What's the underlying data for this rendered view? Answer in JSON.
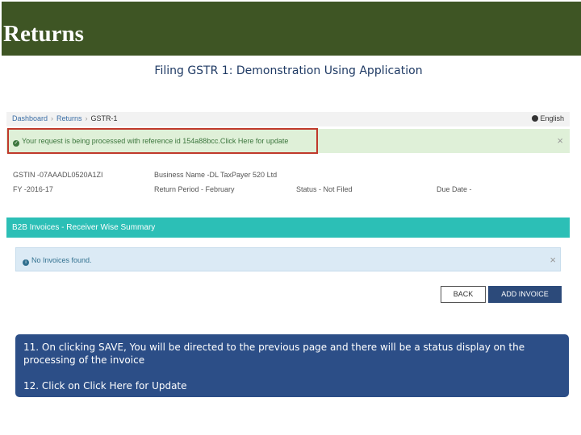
{
  "slide": {
    "title": "Returns",
    "subtitle": "Filing GSTR 1: Demonstration Using Application"
  },
  "breadcrumb": {
    "items": [
      "Dashboard",
      "Returns",
      "GSTR-1"
    ],
    "language": "English"
  },
  "success_alert": {
    "message": "Your request is being processed with reference id 154a88bcc.",
    "link": "Click Here for update",
    "close": "×"
  },
  "return_info": {
    "gstin": "GSTIN -07AAADL0520A1ZI",
    "business_name": "Business Name -DL TaxPayer 520 Ltd",
    "fy": "FY -2016-17",
    "return_period": "Return Period - February",
    "status": "Status - Not Filed",
    "due_date": "Due Date -"
  },
  "section": {
    "title": "B2B Invoices - Receiver Wise Summary"
  },
  "info_alert": {
    "message": "No Invoices found.",
    "close": "×"
  },
  "buttons": {
    "back": "BACK",
    "add_invoice": "ADD INVOICE"
  },
  "callout": {
    "step11": "11. On clicking SAVE, You will be directed to the previous page and there will be a status display on the processing of the invoice",
    "step12": "12. Click on Click Here for Update"
  },
  "colors": {
    "title_bar": "#3e5524",
    "section_bar": "#2cbfb6",
    "success_bg": "#dff0d8",
    "info_bg": "#dbeaf5",
    "add_button": "#2c4a7a",
    "callout_bg": "#2c4e87",
    "highlight_border": "#c0392b"
  }
}
